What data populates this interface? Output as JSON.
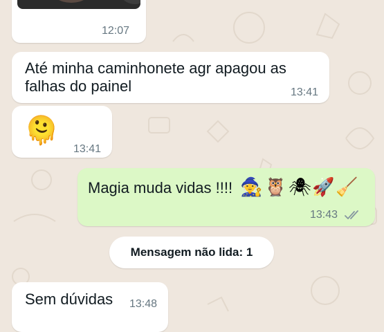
{
  "chat": {
    "image_message": {
      "time": "12:07"
    },
    "messages": [
      {
        "direction": "incoming",
        "text_line1": "Até minha caminhonete agr apagou as",
        "text_line2": "falhas do painel",
        "time": "13:41"
      },
      {
        "direction": "incoming",
        "emoji": "🫠",
        "emoji_name": "melting-face-emoji",
        "time": "13:41"
      },
      {
        "direction": "outgoing",
        "text": "Magia muda vidas !!!!",
        "emojis": [
          "🧙",
          "🦉",
          "🕷",
          "🚀",
          "🧹"
        ],
        "time": "13:43",
        "status": "read"
      },
      {
        "direction": "incoming",
        "text": "Sem dúvidas",
        "time": "13:48"
      }
    ],
    "unread_divider": "Mensagem não lida: 1"
  },
  "colors": {
    "wallpaper": "#efe7de",
    "incoming_bubble": "#ffffff",
    "outgoing_bubble": "#dcf8c6",
    "timestamp": "#667781",
    "read_ticks": "#8696a0"
  }
}
